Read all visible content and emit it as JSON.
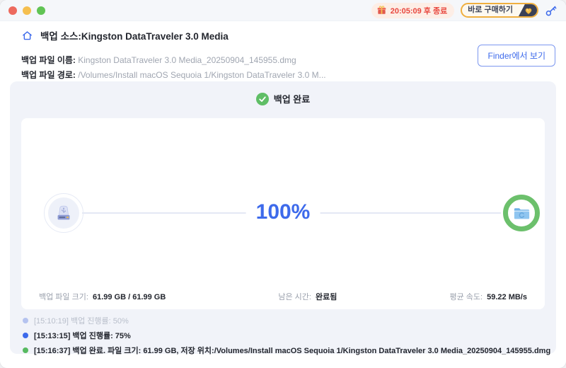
{
  "topbar": {
    "timer_text": "20:05:09 후 종료",
    "buy_label": "바로 구매하기"
  },
  "header": {
    "title": "백업 소스:Kingston DataTraveler 3.0 Media",
    "file_name_label": "백업 파일 이름:",
    "file_name_value": "Kingston DataTraveler 3.0 Media_20250904_145955.dmg",
    "file_path_label": "백업 파일 경로:",
    "file_path_value": "/Volumes/Install macOS Sequoia 1/Kingston DataTraveler 3.0 M...",
    "finder_button": "Finder에서 보기"
  },
  "progress": {
    "badge": "백업 완료",
    "percent": "100%",
    "stats": [
      {
        "label": "백업 파일 크기:",
        "value": "61.99 GB / 61.99 GB"
      },
      {
        "label": "남은 시간:",
        "value": "완료됨"
      },
      {
        "label": "평균 속도:",
        "value": "59.22 MB/s"
      }
    ]
  },
  "logs": [
    {
      "text": "[15:10:19] 백업 진행률: 50%"
    },
    {
      "text": "[15:13:15] 백업 진행률: 75%"
    },
    {
      "text": "[15:16:37] 백업 완료. 파일 크기: 61.99 GB, 저장 위치:/Volumes/Install macOS Sequoia 1/Kingston DataTraveler 3.0 Media_20250904_145955.dmg"
    }
  ],
  "colors": {
    "accent_blue": "#3d6aeb",
    "success_green": "#5fbe66",
    "timer_red": "#e8473e",
    "gold": "#efaf3f",
    "panel_bg": "#f1f3f9"
  }
}
